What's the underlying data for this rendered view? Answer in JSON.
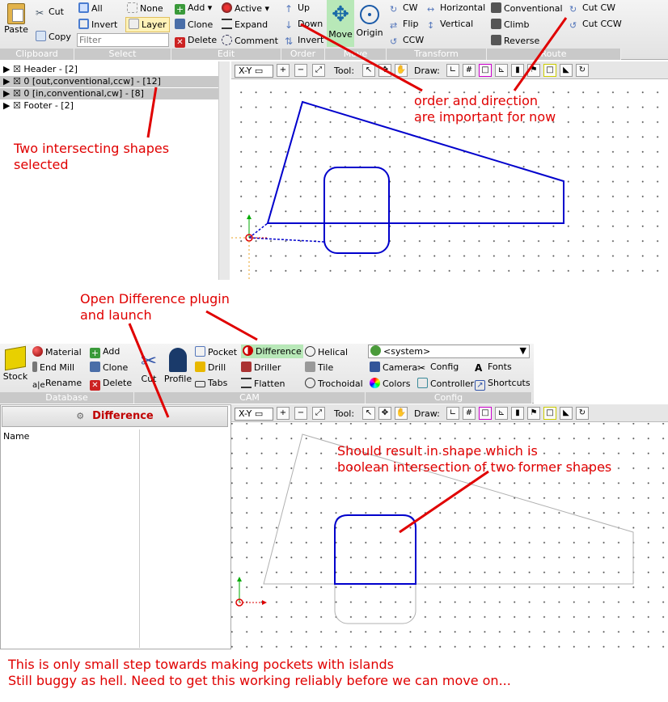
{
  "top_ribbon": {
    "clipboard": {
      "paste": "Paste",
      "cut": "Cut",
      "copy": "Copy",
      "label": "Clipboard"
    },
    "select": {
      "all": "All",
      "none": "None",
      "invert": "Invert",
      "layer": "Layer",
      "filter_placeholder": "Filter",
      "label": "Select"
    },
    "edit": {
      "add": "Add",
      "active": "Active",
      "clone": "Clone",
      "expand": "Expand",
      "delete": "Delete",
      "comment": "Comment",
      "label": "Edit"
    },
    "order": {
      "up": "Up",
      "down": "Down",
      "invert": "Invert",
      "label": "Order"
    },
    "move": {
      "move": "Move",
      "origin": "Origin",
      "label": "Move"
    },
    "transform": {
      "cw": "CW",
      "horizontal": "Horizontal",
      "flip": "Flip",
      "vertical": "Vertical",
      "ccw": "CCW",
      "label": "Transform"
    },
    "route": {
      "conventional": "Conventional",
      "cut_cw": "Cut CW",
      "climb": "Climb",
      "cut_ccw": "Cut CCW",
      "reverse": "Reverse",
      "label": "Route"
    }
  },
  "tree": [
    {
      "label": "Header - [2]",
      "selected": false
    },
    {
      "label": "0 [out,conventional,ccw] - [12]",
      "selected": true
    },
    {
      "label": "0 [in,conventional,cw] - [8]",
      "selected": true
    },
    {
      "label": "Footer - [2]",
      "selected": false
    }
  ],
  "viewport_toolbar": {
    "view": "X-Y",
    "tool_label": "Tool:",
    "draw_label": "Draw:"
  },
  "bottom_ribbon": {
    "database": {
      "stock": "Stock",
      "material": "Material",
      "end_mill": "End Mill",
      "rename": "Rename",
      "add": "Add",
      "clone": "Clone",
      "delete": "Delete",
      "label": "Database"
    },
    "cam": {
      "cut": "Cut",
      "profile": "Profile",
      "pocket": "Pocket",
      "difference": "Difference",
      "helical": "Helical",
      "drill": "Drill",
      "driller": "Driller",
      "tile": "Tile",
      "tabs": "Tabs",
      "flatten": "Flatten",
      "trochoidal": "Trochoidal",
      "label": "CAM"
    },
    "config": {
      "system": "<system>",
      "camera": "Camera",
      "config": "Config",
      "fonts": "Fonts",
      "colors": "Colors",
      "controller": "Controller",
      "shortcuts": "Shortcuts",
      "label": "Config"
    }
  },
  "plugin_panel": {
    "title": "Difference",
    "column_name": "Name"
  },
  "annotations": {
    "two_shapes": [
      "Two intersecting shapes",
      "selected"
    ],
    "order": [
      "order and direction",
      "are important for now"
    ],
    "open_plugin": [
      "Open Difference plugin",
      "and launch"
    ],
    "result": [
      "Should result in shape which is",
      "boolean intersection of two former shapes"
    ],
    "footer": [
      "This is only small step towards making pockets with islands",
      "Still buggy as hell. Need to get this working reliably before we can move on..."
    ]
  },
  "colors": {
    "annotation": "#e00000",
    "shape": "#0000cc",
    "ribbon_label": "#c9c9c9",
    "selected_row": "#c8c8c8"
  }
}
